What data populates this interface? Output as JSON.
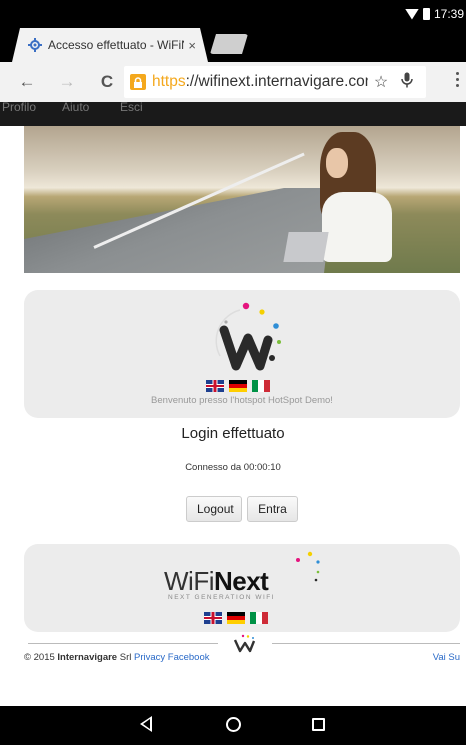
{
  "status_bar": {
    "time": "17:39"
  },
  "browser": {
    "tab_title": "Accesso effettuato - WiFiNe",
    "tab_close": "×",
    "url_scheme": "https",
    "url_rest": "://wifinext.internavigare.com/H",
    "back_icon": "←",
    "forward_icon": "→",
    "reload_icon": "C",
    "star_icon": "☆",
    "mic_icon": "🎙"
  },
  "site_nav": {
    "items": [
      "Profilo",
      "Aiuto",
      "Esci"
    ]
  },
  "welcome_box": {
    "welcome_text": "Benvenuto presso l'hotspot HotSpot Demo!"
  },
  "login": {
    "title": "Login effettuato",
    "connected_text": "Connesso da 00:00:10",
    "logout_label": "Logout",
    "enter_label": "Entra"
  },
  "brand_box": {
    "brand_light": "WiFi",
    "brand_bold": "Next",
    "tagline": "NEXT GENERATION WIFI"
  },
  "footer": {
    "copyright_prefix": "© 2015 ",
    "company": "Internavigare",
    "company_suffix": " Srl ",
    "privacy_link": "Privacy",
    "facebook_link": "Facebook",
    "top_link": "Vai Su"
  },
  "colors": {
    "accent_https": "#f4a81d",
    "link": "#2a6ac8",
    "box_bg": "#ececec"
  }
}
